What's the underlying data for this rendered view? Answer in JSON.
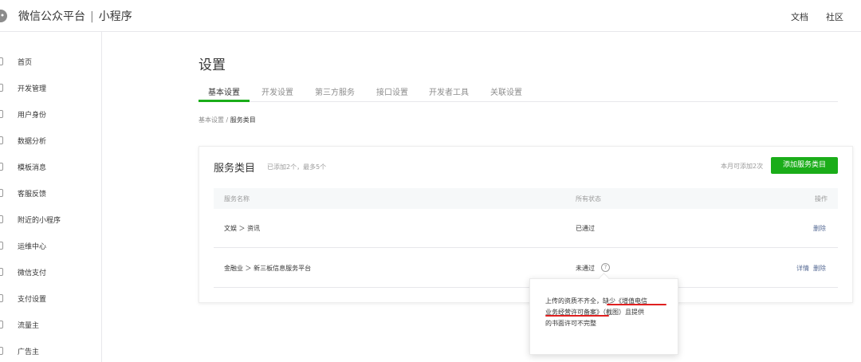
{
  "header": {
    "brand": "微信公众平台",
    "separator": "|",
    "product": "小程序",
    "links": [
      "文档",
      "社区"
    ]
  },
  "sidebar": {
    "items": [
      {
        "label": "首页",
        "icon": "home-icon"
      },
      {
        "label": "开发管理",
        "icon": "code-icon"
      },
      {
        "label": "用户身份",
        "icon": "user-icon"
      },
      {
        "label": "数据分析",
        "icon": "chart-icon"
      },
      {
        "label": "模板消息",
        "icon": "message-icon"
      },
      {
        "label": "客服反馈",
        "icon": "support-icon"
      },
      {
        "label": "附近的小程序",
        "icon": "location-icon"
      },
      {
        "label": "运维中心",
        "icon": "ops-icon"
      },
      {
        "label": "微信支付",
        "icon": "pay-icon"
      },
      {
        "label": "支付设置",
        "icon": "settings-icon"
      },
      {
        "label": "流量主",
        "icon": "traffic-icon"
      },
      {
        "label": "广告主",
        "icon": "ad-icon"
      }
    ]
  },
  "main": {
    "title": "设置",
    "tabs": [
      {
        "label": "基本设置",
        "active": true
      },
      {
        "label": "开发设置",
        "active": false
      },
      {
        "label": "第三方服务",
        "active": false
      },
      {
        "label": "接口设置",
        "active": false
      },
      {
        "label": "开发者工具",
        "active": false
      },
      {
        "label": "关联设置",
        "active": false
      }
    ],
    "breadcrumb": {
      "parent": "基本设置",
      "sep": " / ",
      "current": "服务类目"
    }
  },
  "card": {
    "title": "服务类目",
    "subtitle": "已添加2个，最多5个",
    "quota": "本月可添加2次",
    "add_button": "添加服务类目",
    "columns": [
      "服务名称",
      "所有状态",
      "操作"
    ],
    "rows": [
      {
        "name": "文娱 ＞ 资讯",
        "status": "已通过",
        "actions": [
          "删除"
        ]
      },
      {
        "name": "金融业 ＞ 新三板信息服务平台",
        "status": "未通过",
        "actions": [
          "详情",
          "删除"
        ]
      }
    ],
    "help_glyph": "?"
  },
  "popover": {
    "lines": [
      "上传的资质不齐全，缺少《增值电信",
      "业务经营许可备案》（截图）且提供",
      "的书面许可不完整"
    ]
  },
  "colors": {
    "accent": "#1aad19",
    "link": "#576b95",
    "annotation": "#e02020"
  }
}
